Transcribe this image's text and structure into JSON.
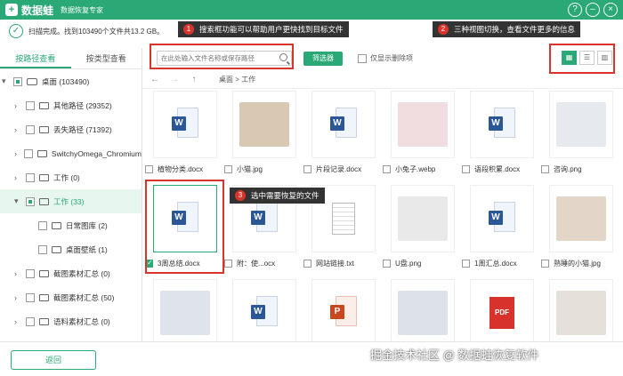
{
  "app": {
    "logo_mark": "+",
    "name": "数据蛙",
    "subtitle": "数据恢复专家"
  },
  "window_controls": {
    "help": "?",
    "minimize": "–",
    "close": "×"
  },
  "scan": {
    "status": "扫描完成。找到103490个文件共13.2 GB。"
  },
  "callouts": {
    "c1": {
      "num": "1",
      "text": "搜索框功能可以帮助用户更快找到目标文件"
    },
    "c2": {
      "num": "2",
      "text": "三种视图切换，查看文件更多的信息"
    },
    "c3": {
      "num": "3",
      "text": "选中需要恢复的文件"
    }
  },
  "sidebar": {
    "tabs": [
      "按路径查看",
      "按类型查看"
    ],
    "items": [
      {
        "label": "桌面 (103490)",
        "arrow": "▾"
      },
      {
        "label": "其他路径 (29352)",
        "arrow": "›"
      },
      {
        "label": "丢失路径 (71392)",
        "arrow": "›"
      },
      {
        "label": "SwitchyOmega_Chromium",
        "arrow": "›"
      },
      {
        "label": "工作 (0)",
        "arrow": "›"
      },
      {
        "label": "工作 (33)",
        "arrow": "▾"
      },
      {
        "label": "日常图库 (2)",
        "arrow": ""
      },
      {
        "label": "桌面壁纸 (1)",
        "arrow": ""
      },
      {
        "label": "截图素材汇总 (0)",
        "arrow": "›"
      },
      {
        "label": "截图素材汇总 (50)",
        "arrow": "›"
      },
      {
        "label": "语料素材汇总 (0)",
        "arrow": "›"
      }
    ]
  },
  "toolbar": {
    "search_placeholder": "在此处输入文件名称或保存路径",
    "filter_label": "筛选器",
    "only_deleted_label": "仅显示删除项",
    "view_icons": {
      "grid": "▦",
      "list": "☰",
      "detail": "▥"
    }
  },
  "nav": {
    "back": "←",
    "forward": "→",
    "up": "↑",
    "breadcrumb": "桌面 > 工作"
  },
  "files": [
    {
      "name": "植物分类.docx",
      "type": "word",
      "checked": false
    },
    {
      "name": "小猫.jpg",
      "type": "photo",
      "color": "#d9c8b4",
      "checked": false
    },
    {
      "name": "片段记录.docx",
      "type": "word",
      "checked": false
    },
    {
      "name": "小兔子.webp",
      "type": "photo",
      "color": "#f1dde0",
      "checked": false
    },
    {
      "name": "语段积累.docx",
      "type": "word",
      "checked": false
    },
    {
      "name": "咨询.png",
      "type": "photo",
      "color": "#e6e9ee",
      "checked": false
    },
    {
      "name": "3周总结.docx",
      "type": "word",
      "checked": true
    },
    {
      "name": "附：使...ocx",
      "type": "word",
      "checked": false
    },
    {
      "name": "网站链接.txt",
      "type": "text",
      "checked": false
    },
    {
      "name": "U盘.png",
      "type": "photo",
      "color": "#e9e9e9",
      "checked": false
    },
    {
      "name": "1周汇总.docx",
      "type": "word",
      "checked": false
    },
    {
      "name": "熟睡的小猫.jpg",
      "type": "photo",
      "color": "#e3d6c8",
      "checked": false
    },
    {
      "name": "",
      "type": "photo",
      "color": "#dfe3ea",
      "checked": false
    },
    {
      "name": "",
      "type": "word",
      "checked": false
    },
    {
      "name": "",
      "type": "ppt",
      "checked": false
    },
    {
      "name": "",
      "type": "photo",
      "color": "#dde2e8",
      "checked": false
    },
    {
      "name": "",
      "type": "pdf",
      "checked": false
    },
    {
      "name": "",
      "type": "photo",
      "color": "#e5e0da",
      "checked": false
    }
  ],
  "badges": {
    "word": "W",
    "ppt": "P",
    "pdf": "PDF"
  },
  "bottom": {
    "back_label": "返回"
  },
  "watermark": "掘金技术社区 @ 数据蛙恢复软件",
  "colors": {
    "brand": "#2aa876",
    "callout_red": "#d9342b"
  }
}
